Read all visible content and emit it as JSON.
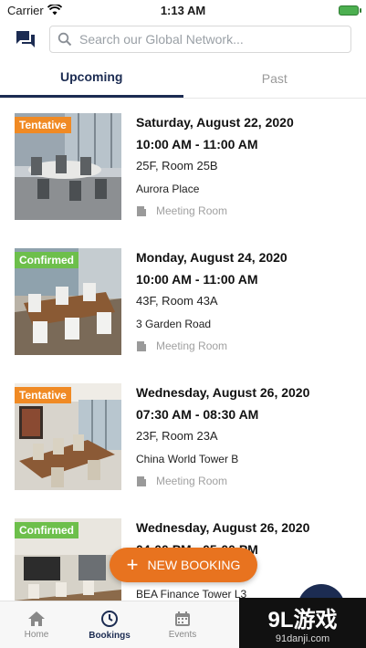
{
  "status_bar": {
    "carrier": "Carrier",
    "time": "1:13 AM"
  },
  "search": {
    "placeholder": "Search our Global Network..."
  },
  "tabs": [
    {
      "label": "Upcoming",
      "active": true
    },
    {
      "label": "Past",
      "active": false
    }
  ],
  "bookings": [
    {
      "status": "Tentative",
      "date": "Saturday, August 22, 2020",
      "time": "10:00 AM - 11:00 AM",
      "room": "25F, Room 25B",
      "building": "Aurora Place",
      "type": "Meeting Room"
    },
    {
      "status": "Confirmed",
      "date": "Monday, August 24, 2020",
      "time": "10:00 AM - 11:00 AM",
      "room": "43F, Room 43A",
      "building": "3 Garden Road",
      "type": "Meeting Room"
    },
    {
      "status": "Tentative",
      "date": "Wednesday, August 26, 2020",
      "time": "07:30 AM - 08:30 AM",
      "room": "23F, Room 23A",
      "building": "China World Tower B",
      "type": "Meeting Room"
    },
    {
      "status": "Confirmed",
      "date": "Wednesday, August 26, 2020",
      "time": "04:00 PM - 05:00 PM",
      "room": "",
      "building": "BEA Finance Tower L3",
      "type": ""
    }
  ],
  "fab": {
    "label": "NEW BOOKING"
  },
  "nav": [
    {
      "label": "Home",
      "icon": "home-icon"
    },
    {
      "label": "Bookings",
      "icon": "clock-icon"
    },
    {
      "label": "Events",
      "icon": "calendar-icon"
    }
  ],
  "watermark": {
    "big": "9L游戏",
    "small": "91danji.com"
  },
  "colors": {
    "navy": "#1c2c52",
    "orange": "#e8731f",
    "tentative": "#f08a24",
    "confirmed": "#6dbf4b"
  }
}
